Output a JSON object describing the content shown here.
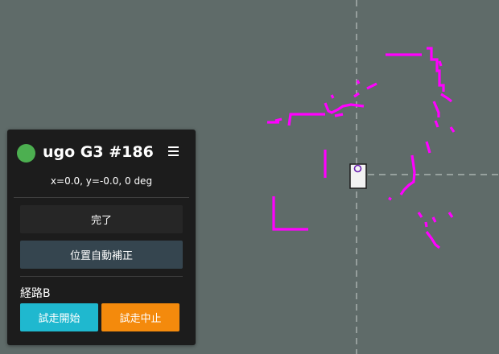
{
  "robot": {
    "name": "ugo G3 #186",
    "status_color": "#4caf50",
    "pose_text": "x=0.0, y=-0.0, 0 deg"
  },
  "controls": {
    "done_label": "完了",
    "auto_correct_label": "位置自動補正"
  },
  "route": {
    "label": "経路B",
    "start_label": "試走開始",
    "stop_label": "試走中止"
  },
  "colors": {
    "map_background": "#5f6b69",
    "scan": "#ff00ff",
    "panel": "#1c1c1c",
    "start_button": "#1fb8cf",
    "stop_button": "#f48a0c"
  }
}
